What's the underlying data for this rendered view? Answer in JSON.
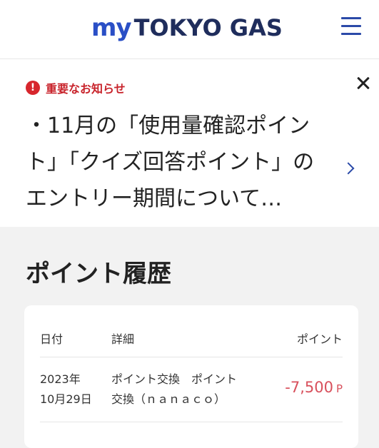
{
  "header": {
    "logo_my": "my",
    "logo_main": "TOKYO GAS",
    "menu_icon": "hamburger-menu-icon"
  },
  "notice": {
    "label": "重要なお知らせ",
    "alert_icon": "exclamation-circle-icon",
    "alert_symbol": "!",
    "text": "・11月の「使用量確認ポイント」「クイズ回答ポイント」のエントリー期間について…",
    "close_icon": "close-icon",
    "link_icon": "chevron-right-icon"
  },
  "points": {
    "title": "ポイント履歴",
    "columns": {
      "date": "日付",
      "detail": "詳細",
      "points": "ポイント"
    },
    "rows": [
      {
        "date_year": "2023年",
        "date_day": "10月29日",
        "detail_line1": "ポイント交換　ポイント",
        "detail_line2": "交換（ｎａｎａｃｏ）",
        "amount": "-7,500",
        "unit": "P"
      }
    ]
  },
  "colors": {
    "brand_blue": "#2a4fc6",
    "brand_navy": "#1f2d5c",
    "alert_red": "#d7262d",
    "negative_points": "#d8505c"
  }
}
